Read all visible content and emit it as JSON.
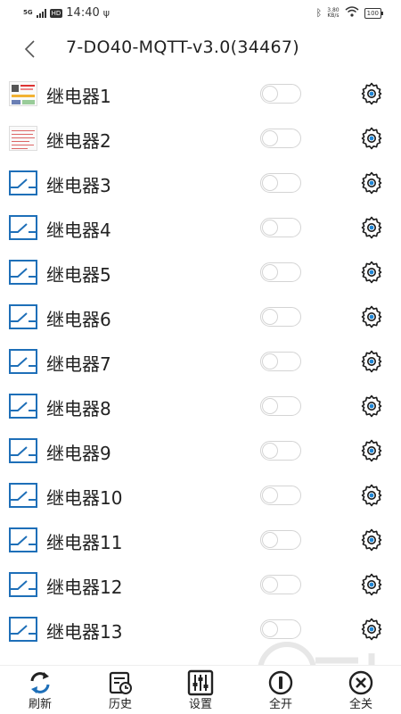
{
  "status_bar": {
    "network": "5G",
    "hd": "HD",
    "time": "14:40",
    "usb_icon": "usb-icon",
    "bluetooth_icon": "bluetooth-icon",
    "speed_value": "3.80",
    "speed_unit": "KB/s",
    "wifi_icon": "wifi-icon",
    "battery": "100"
  },
  "header": {
    "back_icon": "chevron-left-icon",
    "title": "7-DO40-MQTT-v3.0(34467)"
  },
  "relays": [
    {
      "label": "继电器1",
      "icon": "image-thumbnail",
      "on": false
    },
    {
      "label": "继电器2",
      "icon": "image-thumbnail",
      "on": false
    },
    {
      "label": "继电器3",
      "icon": "switch-icon",
      "on": false
    },
    {
      "label": "继电器4",
      "icon": "switch-icon",
      "on": false
    },
    {
      "label": "继电器5",
      "icon": "switch-icon",
      "on": false
    },
    {
      "label": "继电器6",
      "icon": "switch-icon",
      "on": false
    },
    {
      "label": "继电器7",
      "icon": "switch-icon",
      "on": false
    },
    {
      "label": "继电器8",
      "icon": "switch-icon",
      "on": false
    },
    {
      "label": "继电器9",
      "icon": "switch-icon",
      "on": false
    },
    {
      "label": "继电器10",
      "icon": "switch-icon",
      "on": false
    },
    {
      "label": "继电器11",
      "icon": "switch-icon",
      "on": false
    },
    {
      "label": "继电器12",
      "icon": "switch-icon",
      "on": false
    },
    {
      "label": "继电器13",
      "icon": "switch-icon",
      "on": false
    }
  ],
  "bottom_bar": {
    "refresh": "刷新",
    "history": "历史",
    "settings": "设置",
    "all_on": "全开",
    "all_off": "全关"
  },
  "colors": {
    "accent_blue": "#1e6fb8",
    "gear_dark": "#1a1a1a",
    "gear_dot": "#1f86d6",
    "toggle_border": "#d4d4d4"
  }
}
